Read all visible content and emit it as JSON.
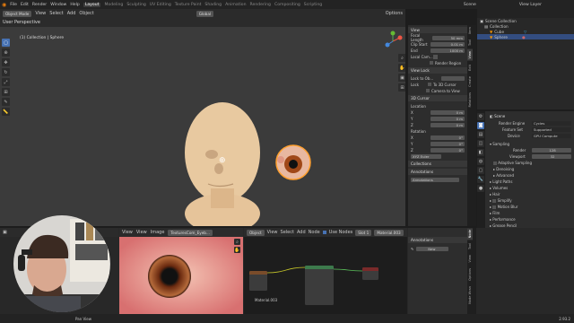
{
  "topbar": {
    "menus": [
      "File",
      "Edit",
      "Render",
      "Window",
      "Help"
    ],
    "workspaces": [
      "Layout",
      "Modeling",
      "Sculpting",
      "UV Editing",
      "Texture Paint",
      "Shading",
      "Animation",
      "Rendering",
      "Compositing",
      "Scripting"
    ],
    "active_workspace": "Layout",
    "scene": "Scene",
    "view_layer": "View Layer"
  },
  "viewport": {
    "mode": "Object Mode",
    "menus": [
      "View",
      "Select",
      "Add",
      "Object"
    ],
    "orientation": "Global",
    "options": "Options",
    "info_line1": "User Perspective",
    "info_line2": "(1) Collection | Sphere"
  },
  "npanel": {
    "view_header": "View",
    "focal_length_label": "Focal Length",
    "focal_length": "50 mm",
    "clip_start_label": "Clip Start",
    "clip_start": "0.01 m",
    "clip_end_label": "End",
    "clip_end": "1000 m",
    "local_camera_label": "Local Cam...",
    "render_region": "Render Region",
    "view_lock": "View Lock",
    "lock_to_obj": "Lock to Ob...",
    "lock_label": "Lock",
    "to_3d_cursor": "To 3D Cursor",
    "camera_to_view": "Camera to View",
    "cursor_header": "3D Cursor",
    "location_label": "Location",
    "x_label": "X",
    "y_label": "Y",
    "z_label": "Z",
    "x_val": "0 m",
    "y_val": "0 m",
    "z_val": "0 m",
    "rotation_label": "Rotation",
    "rx_val": "0°",
    "ry_val": "0°",
    "rz_val": "0°",
    "rot_mode": "XYZ Euler",
    "collections": "Collections",
    "annotations": "Annotations",
    "annot_layer": "Annotations",
    "tabs": [
      "Item",
      "Tool",
      "View",
      "Edit",
      "Create",
      "Relations"
    ]
  },
  "outliner": {
    "title": "Scene Collection",
    "collection": "Collection",
    "cube": "Cube",
    "sphere": "Sphere"
  },
  "properties": {
    "scene_name": "Scene",
    "render_engine_label": "Render Engine",
    "render_engine": "Cycles",
    "feature_set_label": "Feature Set",
    "feature_set": "Supported",
    "device_label": "Device",
    "device": "GPU Compute",
    "sampling": "Sampling",
    "render_label": "Render",
    "render_val": "128",
    "viewport_label": "Viewport",
    "viewport_val": "32",
    "adaptive_sampling": "Adaptive Sampling",
    "denoising": "Denoising",
    "advanced": "Advanced",
    "light_paths": "Light Paths",
    "volumes": "Volumes",
    "hair": "Hair",
    "simplify": "Simplify",
    "motion_blur": "Motion Blur",
    "film": "Film",
    "performance": "Performance",
    "grease_pencil": "Grease Pencil",
    "freestyle": "Freestyle",
    "color_management": "Color Management"
  },
  "image_editor": {
    "menus": [
      "View",
      "View",
      "Image"
    ],
    "image_name": "TexturesCom_Eyeb..."
  },
  "node_editor": {
    "menus": [
      "Object",
      "View",
      "Select",
      "Add",
      "Node"
    ],
    "use_nodes": "Use Nodes",
    "slot": "Slot 1",
    "material": "Material.003",
    "material_label": "Material.003",
    "tabs": [
      "Node",
      "Tool",
      "View",
      "Options",
      "Node Wran"
    ]
  },
  "prop2": {
    "annotations": "Annotations",
    "new": "New"
  },
  "statusbar": {
    "left": "Pan View",
    "right": "2.93.2"
  },
  "colors": {
    "accent": "#4772b3",
    "active_tab": "#3d3d3d",
    "skin": "#e8c9a0"
  }
}
